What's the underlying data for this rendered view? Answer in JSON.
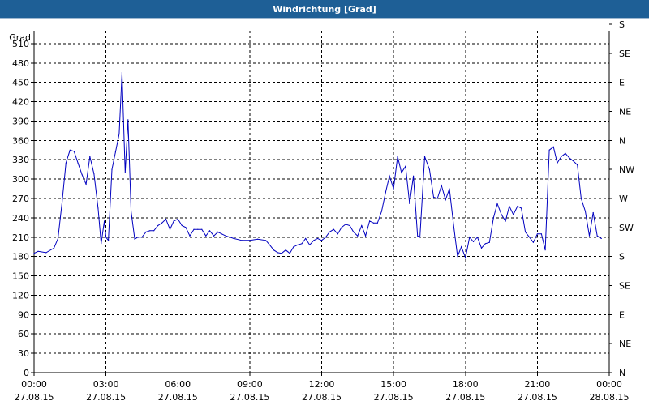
{
  "window": {
    "title": "Windrichtung [Grad]"
  },
  "chart_data": {
    "type": "line",
    "title": "Windrichtung [Grad]",
    "ylabel": "Grad",
    "ylim": [
      0,
      530
    ],
    "yticks": [
      0,
      30,
      60,
      90,
      120,
      150,
      180,
      210,
      240,
      270,
      300,
      330,
      360,
      390,
      420,
      450,
      480,
      510
    ],
    "right_ticks": [
      {
        "value": 0,
        "label": "N"
      },
      {
        "value": 45,
        "label": "NE"
      },
      {
        "value": 90,
        "label": "E"
      },
      {
        "value": 135,
        "label": "SE"
      },
      {
        "value": 180,
        "label": "S"
      },
      {
        "value": 225,
        "label": "SW"
      },
      {
        "value": 270,
        "label": "W"
      },
      {
        "value": 315,
        "label": "NW"
      },
      {
        "value": 360,
        "label": "N"
      },
      {
        "value": 405,
        "label": "NE"
      },
      {
        "value": 450,
        "label": "E"
      },
      {
        "value": 495,
        "label": "SE"
      },
      {
        "value": 540,
        "label": "S"
      }
    ],
    "xlim": [
      0,
      24
    ],
    "xticks": [
      {
        "hour": 0,
        "time": "00:00",
        "date": "27.08.15"
      },
      {
        "hour": 3,
        "time": "03:00",
        "date": "27.08.15"
      },
      {
        "hour": 6,
        "time": "06:00",
        "date": "27.08.15"
      },
      {
        "hour": 9,
        "time": "09:00",
        "date": "27.08.15"
      },
      {
        "hour": 12,
        "time": "12:00",
        "date": "27.08.15"
      },
      {
        "hour": 15,
        "time": "15:00",
        "date": "27.08.15"
      },
      {
        "hour": 18,
        "time": "18:00",
        "date": "27.08.15"
      },
      {
        "hour": 21,
        "time": "21:00",
        "date": "27.08.15"
      },
      {
        "hour": 24,
        "time": "00:00",
        "date": "28.08.15"
      }
    ],
    "grid": true,
    "colors": {
      "line": "#0000c0",
      "grid": "#000000",
      "title_bar": "#1e5f96"
    },
    "series": [
      {
        "points": [
          [
            0.0,
            185
          ],
          [
            0.17,
            188
          ],
          [
            0.5,
            186
          ],
          [
            0.83,
            193
          ],
          [
            1.0,
            208
          ],
          [
            1.17,
            265
          ],
          [
            1.33,
            325
          ],
          [
            1.5,
            345
          ],
          [
            1.67,
            343
          ],
          [
            1.83,
            325
          ],
          [
            2.0,
            307
          ],
          [
            2.17,
            292
          ],
          [
            2.33,
            335
          ],
          [
            2.5,
            308
          ],
          [
            2.67,
            255
          ],
          [
            2.8,
            200
          ],
          [
            2.93,
            235
          ],
          [
            3.0,
            210
          ],
          [
            3.1,
            205
          ],
          [
            3.25,
            315
          ],
          [
            3.4,
            342
          ],
          [
            3.55,
            370
          ],
          [
            3.67,
            465
          ],
          [
            3.8,
            310
          ],
          [
            3.92,
            392
          ],
          [
            4.05,
            250
          ],
          [
            4.2,
            207
          ],
          [
            4.33,
            210
          ],
          [
            4.5,
            210
          ],
          [
            4.67,
            218
          ],
          [
            4.83,
            220
          ],
          [
            5.0,
            220
          ],
          [
            5.17,
            228
          ],
          [
            5.33,
            232
          ],
          [
            5.5,
            238
          ],
          [
            5.67,
            222
          ],
          [
            5.83,
            235
          ],
          [
            6.0,
            238
          ],
          [
            6.17,
            228
          ],
          [
            6.33,
            225
          ],
          [
            6.5,
            212
          ],
          [
            6.67,
            222
          ],
          [
            6.83,
            222
          ],
          [
            7.0,
            222
          ],
          [
            7.17,
            212
          ],
          [
            7.33,
            220
          ],
          [
            7.5,
            212
          ],
          [
            7.67,
            218
          ],
          [
            7.83,
            215
          ],
          [
            8.0,
            212
          ],
          [
            8.33,
            208
          ],
          [
            8.67,
            205
          ],
          [
            9.0,
            205
          ],
          [
            9.33,
            207
          ],
          [
            9.67,
            205
          ],
          [
            9.83,
            198
          ],
          [
            10.0,
            190
          ],
          [
            10.17,
            186
          ],
          [
            10.33,
            185
          ],
          [
            10.5,
            190
          ],
          [
            10.67,
            185
          ],
          [
            10.83,
            195
          ],
          [
            11.0,
            198
          ],
          [
            11.17,
            200
          ],
          [
            11.33,
            208
          ],
          [
            11.5,
            198
          ],
          [
            11.67,
            205
          ],
          [
            11.83,
            208
          ],
          [
            12.0,
            205
          ],
          [
            12.17,
            210
          ],
          [
            12.33,
            218
          ],
          [
            12.5,
            222
          ],
          [
            12.67,
            215
          ],
          [
            12.83,
            225
          ],
          [
            13.0,
            230
          ],
          [
            13.17,
            228
          ],
          [
            13.33,
            218
          ],
          [
            13.5,
            212
          ],
          [
            13.67,
            228
          ],
          [
            13.83,
            212
          ],
          [
            14.0,
            235
          ],
          [
            14.17,
            232
          ],
          [
            14.33,
            232
          ],
          [
            14.5,
            250
          ],
          [
            14.67,
            280
          ],
          [
            14.83,
            305
          ],
          [
            15.0,
            285
          ],
          [
            15.17,
            335
          ],
          [
            15.33,
            310
          ],
          [
            15.5,
            320
          ],
          [
            15.67,
            262
          ],
          [
            15.83,
            305
          ],
          [
            16.0,
            212
          ],
          [
            16.1,
            210
          ],
          [
            16.3,
            335
          ],
          [
            16.5,
            315
          ],
          [
            16.67,
            272
          ],
          [
            16.83,
            270
          ],
          [
            17.0,
            290
          ],
          [
            17.17,
            268
          ],
          [
            17.33,
            285
          ],
          [
            17.5,
            230
          ],
          [
            17.67,
            180
          ],
          [
            17.83,
            195
          ],
          [
            18.0,
            178
          ],
          [
            18.17,
            210
          ],
          [
            18.33,
            203
          ],
          [
            18.5,
            210
          ],
          [
            18.67,
            193
          ],
          [
            18.83,
            200
          ],
          [
            19.0,
            202
          ],
          [
            19.17,
            240
          ],
          [
            19.33,
            262
          ],
          [
            19.5,
            245
          ],
          [
            19.67,
            235
          ],
          [
            19.83,
            258
          ],
          [
            20.0,
            245
          ],
          [
            20.17,
            258
          ],
          [
            20.33,
            255
          ],
          [
            20.5,
            218
          ],
          [
            20.67,
            210
          ],
          [
            20.83,
            202
          ],
          [
            21.0,
            215
          ],
          [
            21.17,
            215
          ],
          [
            21.33,
            190
          ],
          [
            21.5,
            345
          ],
          [
            21.67,
            350
          ],
          [
            21.83,
            325
          ],
          [
            22.0,
            335
          ],
          [
            22.17,
            340
          ],
          [
            22.33,
            333
          ],
          [
            22.5,
            328
          ],
          [
            22.67,
            322
          ],
          [
            22.83,
            270
          ],
          [
            23.0,
            250
          ],
          [
            23.17,
            212
          ],
          [
            23.33,
            248
          ],
          [
            23.5,
            212
          ],
          [
            23.67,
            208
          ]
        ]
      }
    ]
  }
}
